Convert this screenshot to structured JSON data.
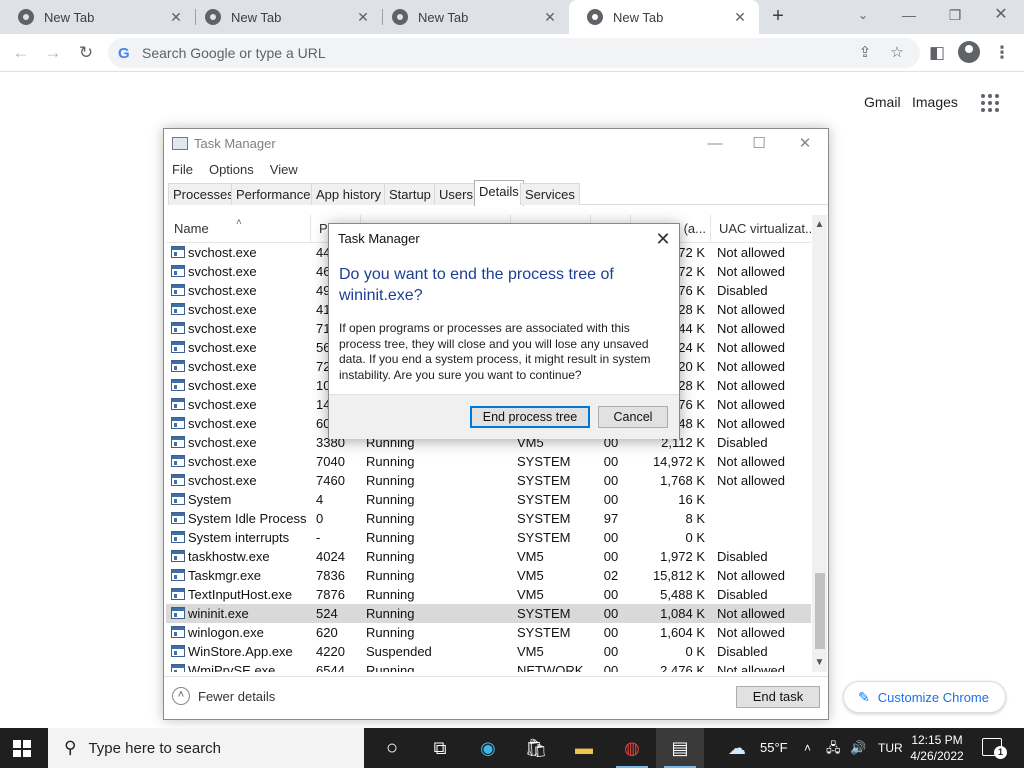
{
  "browser": {
    "tabs": [
      {
        "title": "New Tab",
        "active": false
      },
      {
        "title": "New Tab",
        "active": false
      },
      {
        "title": "New Tab",
        "active": false
      },
      {
        "title": "New Tab",
        "active": true
      }
    ],
    "omnibox_placeholder": "Search Google or type a URL",
    "ntp": {
      "gmail": "Gmail",
      "images": "Images",
      "customize": "Customize Chrome"
    }
  },
  "task_manager": {
    "title": "Task Manager",
    "menu": [
      "File",
      "Options",
      "View"
    ],
    "tabs": [
      "Processes",
      "Performance",
      "App history",
      "Startup",
      "Users",
      "Details",
      "Services"
    ],
    "active_tab": "Details",
    "columns": {
      "name": "Name",
      "pid": "PI",
      "uac": "UAC virtualizat...",
      "mem": "y (a..."
    },
    "rows": [
      {
        "name": "svchost.exe",
        "pid": "44",
        "status": "",
        "user": "",
        "cpu": "",
        "mem": "72 K",
        "uac": "Not allowed"
      },
      {
        "name": "svchost.exe",
        "pid": "46",
        "status": "",
        "user": "",
        "cpu": "",
        "mem": "972 K",
        "uac": "Not allowed"
      },
      {
        "name": "svchost.exe",
        "pid": "49",
        "status": "",
        "user": "",
        "cpu": "",
        "mem": "76 K",
        "uac": "Disabled"
      },
      {
        "name": "svchost.exe",
        "pid": "41",
        "status": "",
        "user": "",
        "cpu": "",
        "mem": "28 K",
        "uac": "Not allowed"
      },
      {
        "name": "svchost.exe",
        "pid": "71",
        "status": "",
        "user": "",
        "cpu": "",
        "mem": "44 K",
        "uac": "Not allowed"
      },
      {
        "name": "svchost.exe",
        "pid": "56",
        "status": "",
        "user": "",
        "cpu": "",
        "mem": "24 K",
        "uac": "Not allowed"
      },
      {
        "name": "svchost.exe",
        "pid": "72",
        "status": "",
        "user": "",
        "cpu": "",
        "mem": "20 K",
        "uac": "Not allowed"
      },
      {
        "name": "svchost.exe",
        "pid": "10",
        "status": "",
        "user": "",
        "cpu": "",
        "mem": "28 K",
        "uac": "Not allowed"
      },
      {
        "name": "svchost.exe",
        "pid": "14",
        "status": "",
        "user": "",
        "cpu": "",
        "mem": "76 K",
        "uac": "Not allowed"
      },
      {
        "name": "svchost.exe",
        "pid": "60",
        "status": "",
        "user": "",
        "cpu": "",
        "mem": "48 K",
        "uac": "Not allowed"
      },
      {
        "name": "svchost.exe",
        "pid": "3380",
        "status": "Running",
        "user": "VM5",
        "cpu": "00",
        "mem": "2,112 K",
        "uac": "Disabled"
      },
      {
        "name": "svchost.exe",
        "pid": "7040",
        "status": "Running",
        "user": "SYSTEM",
        "cpu": "00",
        "mem": "14,972 K",
        "uac": "Not allowed"
      },
      {
        "name": "svchost.exe",
        "pid": "7460",
        "status": "Running",
        "user": "SYSTEM",
        "cpu": "00",
        "mem": "1,768 K",
        "uac": "Not allowed"
      },
      {
        "name": "System",
        "pid": "4",
        "status": "Running",
        "user": "SYSTEM",
        "cpu": "00",
        "mem": "16 K",
        "uac": ""
      },
      {
        "name": "System Idle Process",
        "pid": "0",
        "status": "Running",
        "user": "SYSTEM",
        "cpu": "97",
        "mem": "8 K",
        "uac": ""
      },
      {
        "name": "System interrupts",
        "pid": "-",
        "status": "Running",
        "user": "SYSTEM",
        "cpu": "00",
        "mem": "0 K",
        "uac": ""
      },
      {
        "name": "taskhostw.exe",
        "pid": "4024",
        "status": "Running",
        "user": "VM5",
        "cpu": "00",
        "mem": "1,972 K",
        "uac": "Disabled"
      },
      {
        "name": "Taskmgr.exe",
        "pid": "7836",
        "status": "Running",
        "user": "VM5",
        "cpu": "02",
        "mem": "15,812 K",
        "uac": "Not allowed"
      },
      {
        "name": "TextInputHost.exe",
        "pid": "7876",
        "status": "Running",
        "user": "VM5",
        "cpu": "00",
        "mem": "5,488 K",
        "uac": "Disabled"
      },
      {
        "name": "wininit.exe",
        "pid": "524",
        "status": "Running",
        "user": "SYSTEM",
        "cpu": "00",
        "mem": "1,084 K",
        "uac": "Not allowed",
        "selected": true
      },
      {
        "name": "winlogon.exe",
        "pid": "620",
        "status": "Running",
        "user": "SYSTEM",
        "cpu": "00",
        "mem": "1,604 K",
        "uac": "Not allowed"
      },
      {
        "name": "WinStore.App.exe",
        "pid": "4220",
        "status": "Suspended",
        "user": "VM5",
        "cpu": "00",
        "mem": "0 K",
        "uac": "Disabled"
      },
      {
        "name": "WmiPrvSE.exe",
        "pid": "6544",
        "status": "Running",
        "user": "NETWORK ...",
        "cpu": "00",
        "mem": "2,476 K",
        "uac": "Not allowed"
      }
    ],
    "fewer_details": "Fewer details",
    "end_task": "End task"
  },
  "dialog": {
    "title": "Task Manager",
    "heading": "Do you want to end the process tree of wininit.exe?",
    "body": "If open programs or processes are associated with this process tree, they will close and you will lose any unsaved data. If you end a system process, it might result in system instability. Are you sure you want to continue?",
    "confirm": "End process tree",
    "cancel": "Cancel"
  },
  "taskbar": {
    "search_placeholder": "Type here to search",
    "weather": "55°F",
    "language": "TUR",
    "time": "12:15 PM",
    "date": "4/26/2022",
    "notifications": "1"
  }
}
